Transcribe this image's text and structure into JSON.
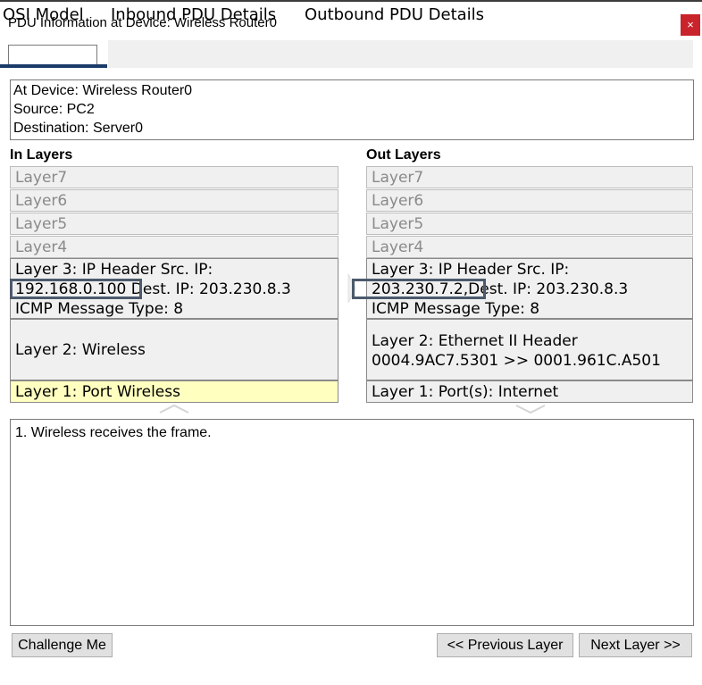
{
  "window": {
    "title": "PDU Information at Device: Wireless Router0",
    "close_glyph": "×"
  },
  "tabs": [
    {
      "label": "OSI Model",
      "active": true
    },
    {
      "label": "Inbound PDU Details",
      "active": false
    },
    {
      "label": "Outbound PDU Details",
      "active": false
    }
  ],
  "info": {
    "device": "At Device: Wireless Router0",
    "source": "Source: PC2",
    "destination": "Destination: Server0"
  },
  "in_layers": {
    "title": "In Layers",
    "layer7": "Layer7",
    "layer6": "Layer6",
    "layer5": "Layer5",
    "layer4": "Layer4",
    "layer3_line1": "Layer 3: IP Header Src. IP:",
    "layer3_src_ip": "192.168.0.100",
    "layer3_dest": "Dest. IP: 203.230.8.3",
    "layer3_line3": "ICMP Message Type: 8",
    "layer2": "Layer 2: Wireless",
    "layer1": "Layer 1: Port Wireless"
  },
  "out_layers": {
    "title": "Out Layers",
    "layer7": "Layer7",
    "layer6": "Layer6",
    "layer5": "Layer5",
    "layer4": "Layer4",
    "layer3_line1": "Layer 3: IP Header Src. IP:",
    "layer3_src_ip": "203.230.7.2,",
    "layer3_dest": "Dest. IP: 203.230.8.3",
    "layer3_line3": "ICMP Message Type: 8",
    "layer2_line1": "Layer 2: Ethernet II Header",
    "layer2_line2": "0004.9AC7.5301 >> 0001.961C.A501",
    "layer1": "Layer 1: Port(s): Internet"
  },
  "description": "1. Wireless receives the frame.",
  "buttons": {
    "challenge": "Challenge Me",
    "previous": "<< Previous Layer",
    "next": "Next Layer >>"
  },
  "colors": {
    "close_bg": "#c9232b",
    "active_layer": "#ffffc0",
    "highlight_box": "#4c5a6c",
    "tab_underline": "#1a3b6a"
  }
}
